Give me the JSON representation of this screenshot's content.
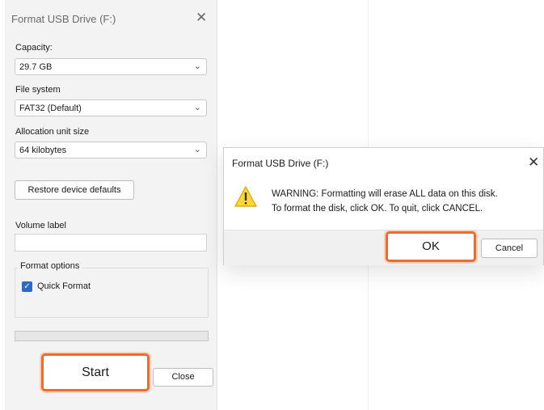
{
  "format_dialog": {
    "title": "Format USB Drive (F:)",
    "close_glyph": "✕",
    "capacity_label": "Capacity:",
    "capacity_value": "29.7 GB",
    "file_system_label": "File system",
    "file_system_value": "FAT32 (Default)",
    "allocation_label": "Allocation unit size",
    "allocation_value": "64 kilobytes",
    "restore_label": "Restore device defaults",
    "volume_label_label": "Volume label",
    "volume_label_value": "",
    "format_options_label": "Format options",
    "quick_format_label": "Quick Format",
    "quick_format_checked": true,
    "progress": 0,
    "start_label": "Start",
    "close_label": "Close",
    "highlight_color": "#ec6b2f",
    "checkbox_color": "#2c69c9"
  },
  "warning_dialog": {
    "title": "Format USB Drive (F:)",
    "close_glyph": "✕",
    "icon": "warning-icon",
    "line1": "WARNING: Formatting will erase ALL data on this disk.",
    "line2": "To format the disk, click OK. To quit, click CANCEL.",
    "ok_label": "OK",
    "cancel_label": "Cancel"
  },
  "icons": {
    "chevron": "⌄",
    "check": "✓"
  }
}
